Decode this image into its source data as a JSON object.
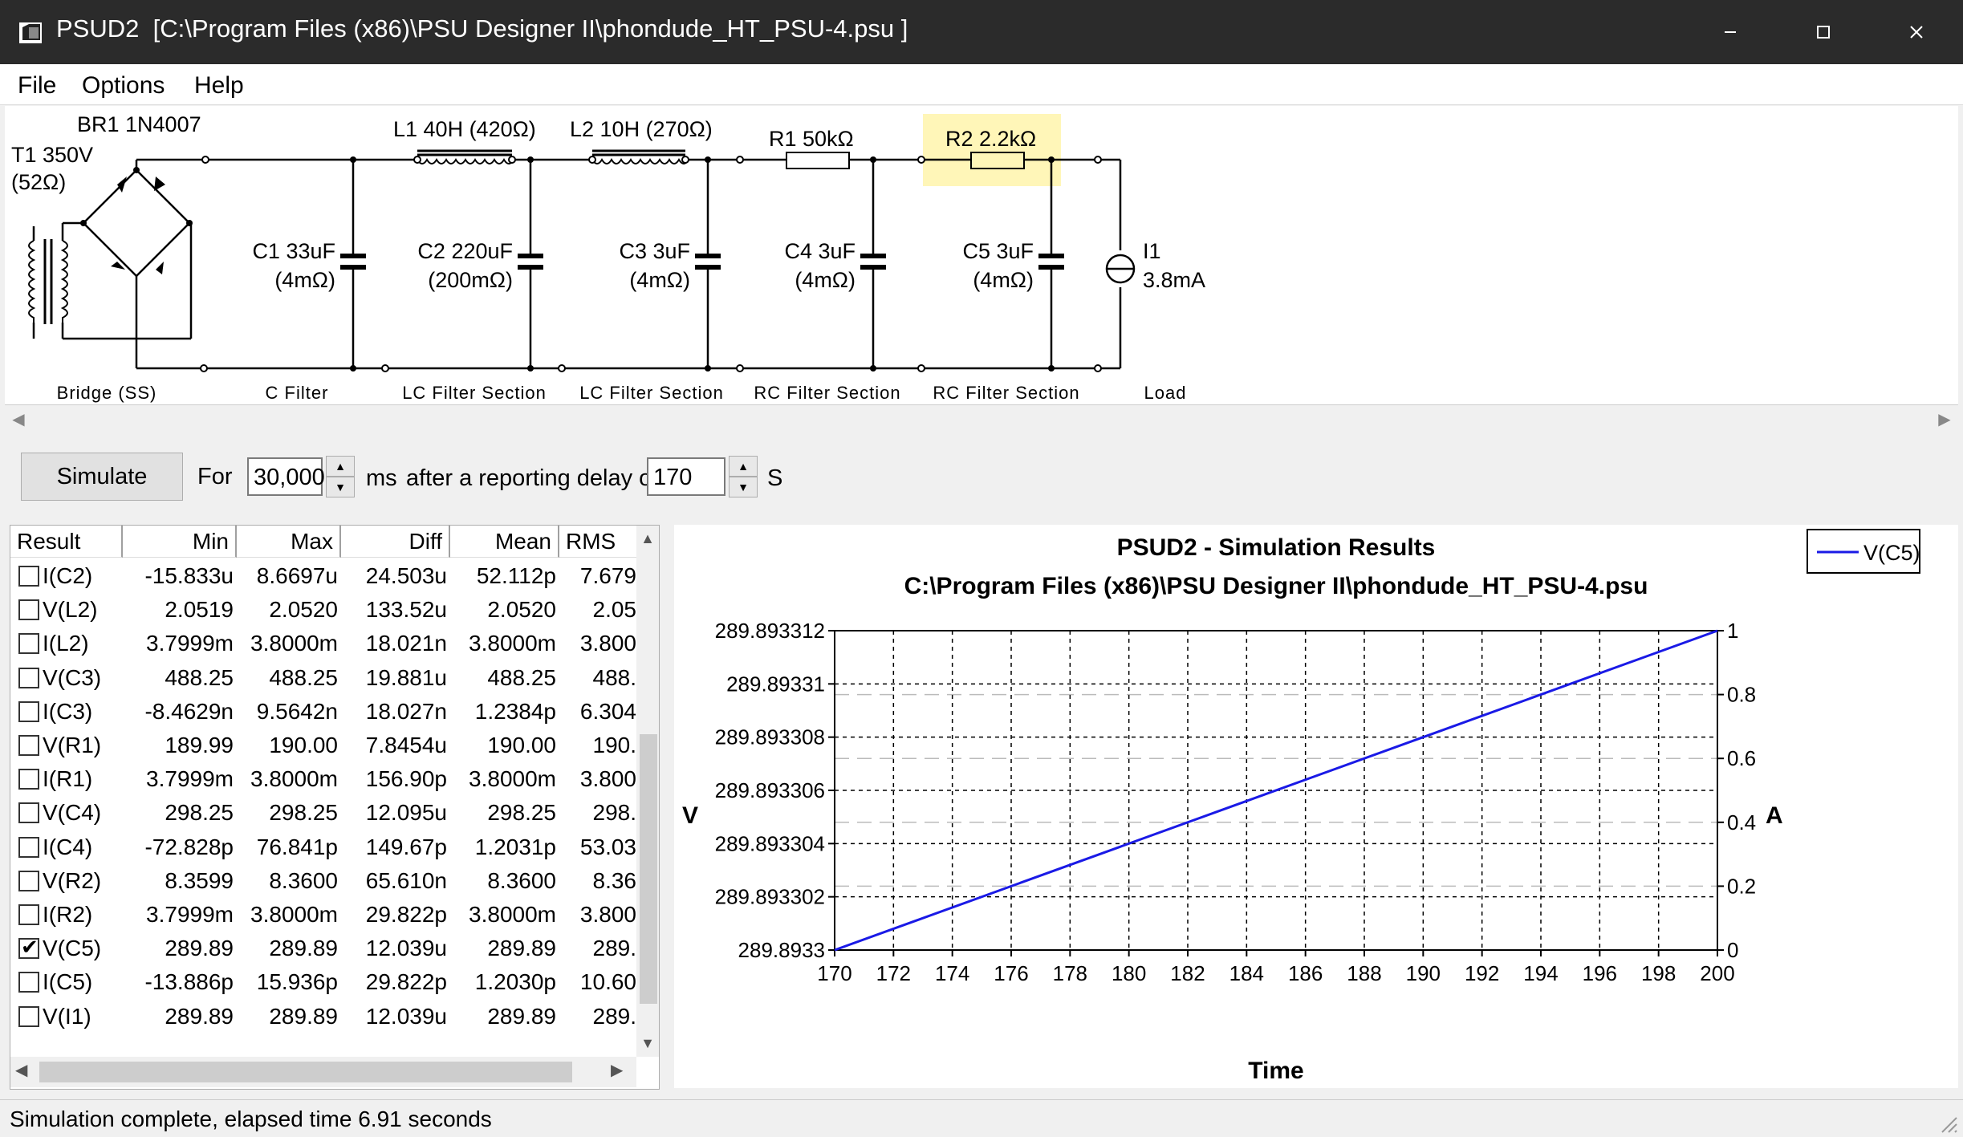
{
  "window": {
    "app_name": "PSUD2",
    "file_path": "[C:\\Program Files (x86)\\PSU Designer II\\phondude_HT_PSU-4.psu ]"
  },
  "menu": [
    "File",
    "Options",
    "Help"
  ],
  "schematic": {
    "transformer": {
      "name": "T1 350V",
      "resistance": "(52Ω)"
    },
    "rectifier": "BR1 1N4007",
    "l1": "L1 40H (420Ω)",
    "l2": "L2 10H (270Ω)",
    "r1": "R1 50kΩ",
    "r2": "R2 2.2kΩ",
    "c1": {
      "name": "C1 33uF",
      "esr": "(4mΩ)"
    },
    "c2": {
      "name": "C2 220uF",
      "esr": "(200mΩ)"
    },
    "c3": {
      "name": "C3 3uF",
      "esr": "(4mΩ)"
    },
    "c4": {
      "name": "C4 3uF",
      "esr": "(4mΩ)"
    },
    "c5": {
      "name": "C5 3uF",
      "esr": "(4mΩ)"
    },
    "load": {
      "name": "I1",
      "value": "3.8mA"
    },
    "sections": [
      "Bridge (SS)",
      "C Filter",
      "LC Filter Section",
      "LC Filter Section",
      "RC Filter Section",
      "RC Filter Section",
      "Load"
    ],
    "highlight_color": "#fff6b8"
  },
  "controls": {
    "simulate": "Simulate",
    "for_label": "For",
    "duration": "30,000",
    "ms_label": "ms",
    "delay_label": "after a reporting delay of",
    "delay": "170",
    "s_label": "S"
  },
  "results": {
    "columns": [
      "Result",
      "Min",
      "Max",
      "Diff",
      "Mean",
      "RMS"
    ],
    "rows": [
      {
        "checked": false,
        "name": "I(C2)",
        "min": "-15.833u",
        "max": "8.6697u",
        "diff": "24.503u",
        "mean": "52.112p",
        "rms": "7.679"
      },
      {
        "checked": false,
        "name": "V(L2)",
        "min": "2.0519",
        "max": "2.0520",
        "diff": "133.52u",
        "mean": "2.0520",
        "rms": "2.05"
      },
      {
        "checked": false,
        "name": "I(L2)",
        "min": "3.7999m",
        "max": "3.8000m",
        "diff": "18.021n",
        "mean": "3.8000m",
        "rms": "3.800"
      },
      {
        "checked": false,
        "name": "V(C3)",
        "min": "488.25",
        "max": "488.25",
        "diff": "19.881u",
        "mean": "488.25",
        "rms": "488."
      },
      {
        "checked": false,
        "name": "I(C3)",
        "min": "-8.4629n",
        "max": "9.5642n",
        "diff": "18.027n",
        "mean": "1.2384p",
        "rms": "6.304"
      },
      {
        "checked": false,
        "name": "V(R1)",
        "min": "189.99",
        "max": "190.00",
        "diff": "7.8454u",
        "mean": "190.00",
        "rms": "190."
      },
      {
        "checked": false,
        "name": "I(R1)",
        "min": "3.7999m",
        "max": "3.8000m",
        "diff": "156.90p",
        "mean": "3.8000m",
        "rms": "3.800"
      },
      {
        "checked": false,
        "name": "V(C4)",
        "min": "298.25",
        "max": "298.25",
        "diff": "12.095u",
        "mean": "298.25",
        "rms": "298."
      },
      {
        "checked": false,
        "name": "I(C4)",
        "min": "-72.828p",
        "max": "76.841p",
        "diff": "149.67p",
        "mean": "1.2031p",
        "rms": "53.03"
      },
      {
        "checked": false,
        "name": "V(R2)",
        "min": "8.3599",
        "max": "8.3600",
        "diff": "65.610n",
        "mean": "8.3600",
        "rms": "8.36"
      },
      {
        "checked": false,
        "name": "I(R2)",
        "min": "3.7999m",
        "max": "3.8000m",
        "diff": "29.822p",
        "mean": "3.8000m",
        "rms": "3.800"
      },
      {
        "checked": true,
        "name": "V(C5)",
        "min": "289.89",
        "max": "289.89",
        "diff": "12.039u",
        "mean": "289.89",
        "rms": "289."
      },
      {
        "checked": false,
        "name": "I(C5)",
        "min": "-13.886p",
        "max": "15.936p",
        "diff": "29.822p",
        "mean": "1.2030p",
        "rms": "10.60"
      },
      {
        "checked": false,
        "name": "V(I1)",
        "min": "289.89",
        "max": "289.89",
        "diff": "12.039u",
        "mean": "289.89",
        "rms": "289."
      }
    ]
  },
  "chart_data": {
    "type": "line",
    "title": "PSUD2 - Simulation Results",
    "subtitle": "C:\\Program Files (x86)\\PSU Designer II\\phondude_HT_PSU-4.psu",
    "xlabel": "Time",
    "ylabel": "V",
    "y2label": "A",
    "xlim": [
      170,
      200
    ],
    "ylim": [
      289.8933,
      289.893312
    ],
    "y2lim": [
      0,
      1
    ],
    "x_ticks": [
      "170",
      "172",
      "174",
      "176",
      "178",
      "180",
      "182",
      "184",
      "186",
      "188",
      "190",
      "192",
      "194",
      "196",
      "198",
      "200"
    ],
    "y_ticks": [
      "289.8933",
      "289.893302",
      "289.893304",
      "289.893306",
      "289.893308",
      "289.89331",
      "289.893312"
    ],
    "y2_ticks": [
      "0",
      "0.2",
      "0.4",
      "0.6",
      "0.8",
      "1"
    ],
    "grid": true,
    "legend_position": "top-right",
    "series": [
      {
        "name": "V(C5)",
        "color": "#1a1ae6",
        "x": [
          170,
          200
        ],
        "y": [
          289.8933,
          289.893312
        ]
      }
    ]
  },
  "status": "Simulation complete, elapsed time 6.91 seconds"
}
